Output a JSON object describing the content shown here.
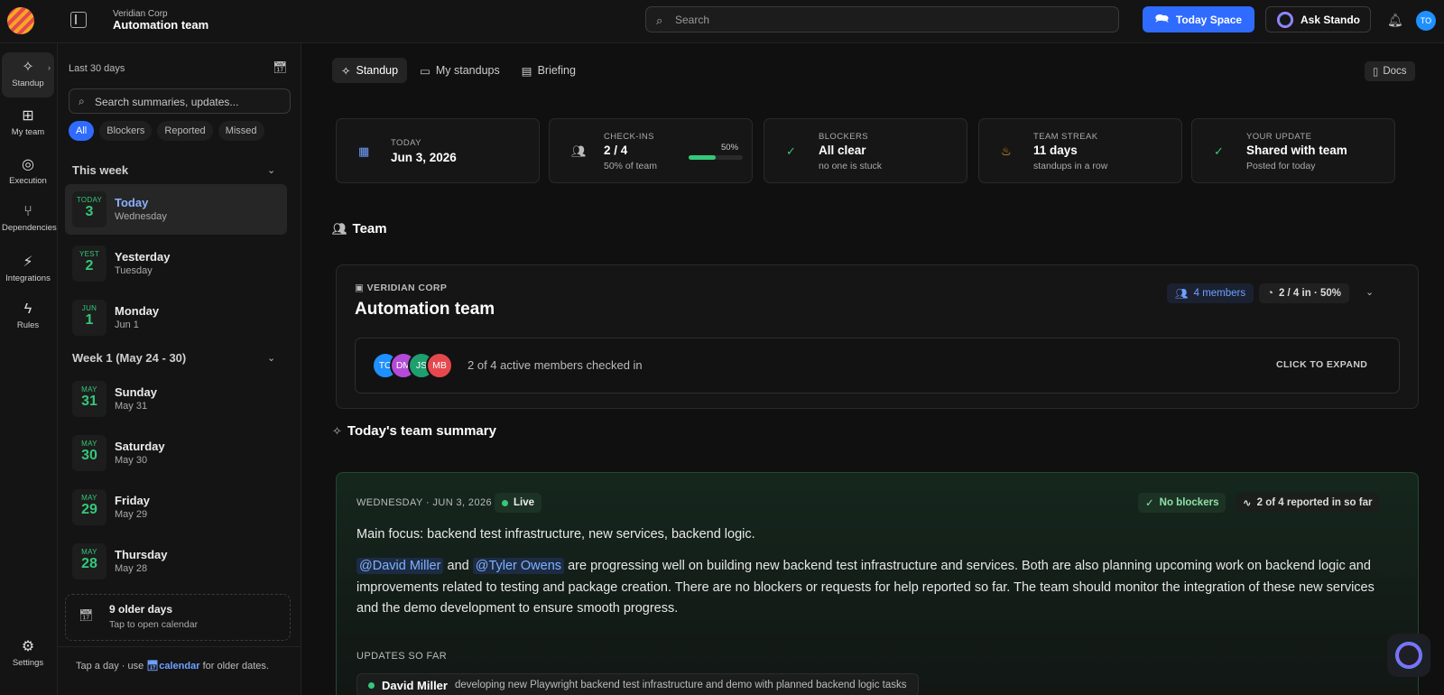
{
  "header": {
    "org": "Veridian Corp",
    "team": "Automation team",
    "search_placeholder": "Search",
    "today_space": "Today Space",
    "ask": "Ask Stando",
    "avatar": "TO"
  },
  "rail": [
    {
      "label": "Standup",
      "icon": "sparkle-icon"
    },
    {
      "label": "My team",
      "icon": "grid-icon"
    },
    {
      "label": "Execution",
      "icon": "target-icon"
    },
    {
      "label": "Dependencies",
      "icon": "branch-icon"
    },
    {
      "label": "Integrations",
      "icon": "plug-icon"
    },
    {
      "label": "Rules",
      "icon": "bolt-icon"
    },
    {
      "label": "Settings",
      "icon": "gear-icon"
    }
  ],
  "sidebar": {
    "range": "Last 30 days",
    "search_placeholder": "Search summaries, updates...",
    "filters": [
      "All",
      "Blockers",
      "Reported",
      "Missed"
    ],
    "this_week": "This week",
    "week1": "Week 1",
    "week1_range": "(May 24 - 30)",
    "days": [
      {
        "mon": "TODAY",
        "num": "3",
        "name": "Today",
        "sub": "Wednesday"
      },
      {
        "mon": "YEST",
        "num": "2",
        "name": "Yesterday",
        "sub": "Tuesday"
      },
      {
        "mon": "JUN",
        "num": "1",
        "name": "Monday",
        "sub": "Jun 1"
      },
      {
        "mon": "MAY",
        "num": "31",
        "name": "Sunday",
        "sub": "May 31"
      },
      {
        "mon": "MAY",
        "num": "30",
        "name": "Saturday",
        "sub": "May 30"
      },
      {
        "mon": "MAY",
        "num": "29",
        "name": "Friday",
        "sub": "May 29"
      },
      {
        "mon": "MAY",
        "num": "28",
        "name": "Thursday",
        "sub": "May 28"
      }
    ],
    "older_title": "9 older days",
    "older_sub": "Tap to open calendar",
    "foot_pre": "Tap a day · use",
    "foot_link": "calendar",
    "foot_post": "for older dates."
  },
  "tabs": [
    "Standup",
    "My standups",
    "Briefing"
  ],
  "docs": "Docs",
  "stats": {
    "today": {
      "label": "TODAY",
      "value": "Jun 3, 2026"
    },
    "checkins": {
      "label": "CHECK-INS",
      "value": "2 / 4",
      "sub": "50% of team",
      "pct_label": "50%",
      "progress": 0.5
    },
    "blockers": {
      "label": "BLOCKERS",
      "value": "All clear",
      "sub": "no one is stuck"
    },
    "streak": {
      "label": "TEAM STREAK",
      "value": "11 days",
      "sub": "standups in a row"
    },
    "update": {
      "label": "YOUR UPDATE",
      "value": "Shared with team",
      "sub": "Posted for today"
    }
  },
  "team_section": "Team",
  "team_card": {
    "org": "VERIDIAN CORP",
    "name": "Automation team",
    "members": "4 members",
    "checkin": "2 / 4 in · 50%",
    "avatars": [
      {
        "initials": "TO",
        "color": "#1e90ff"
      },
      {
        "initials": "DM",
        "color": "#b24bd8"
      },
      {
        "initials": "JS",
        "color": "#1f9e6e"
      },
      {
        "initials": "MB",
        "color": "#e5484d"
      }
    ],
    "checked_in": "2 of 4 active members checked in",
    "expand": "CLICK TO EXPAND"
  },
  "summary_section": "Today's team summary",
  "summary": {
    "date": "WEDNESDAY · JUN 3, 2026",
    "live": "Live",
    "no_blockers": "No blockers",
    "reported": "2 of 4 reported in so far",
    "focus": "Main focus: backend test infrastructure, new services, backend logic.",
    "mention1": "@David Miller",
    "and": "and",
    "mention2": "@Tyler Owens",
    "body": "are progressing well on building new backend test infrastructure and services. Both are also planning upcoming work on backend logic and improvements related to testing and package creation. There are no blockers or requests for help reported so far. The team should monitor the integration of these new services and the demo development to ensure smooth progress.",
    "updates_label": "UPDATES SO FAR",
    "update_name": "David Miller",
    "update_text": "developing new Playwright backend test infrastructure and demo with planned backend logic tasks"
  }
}
